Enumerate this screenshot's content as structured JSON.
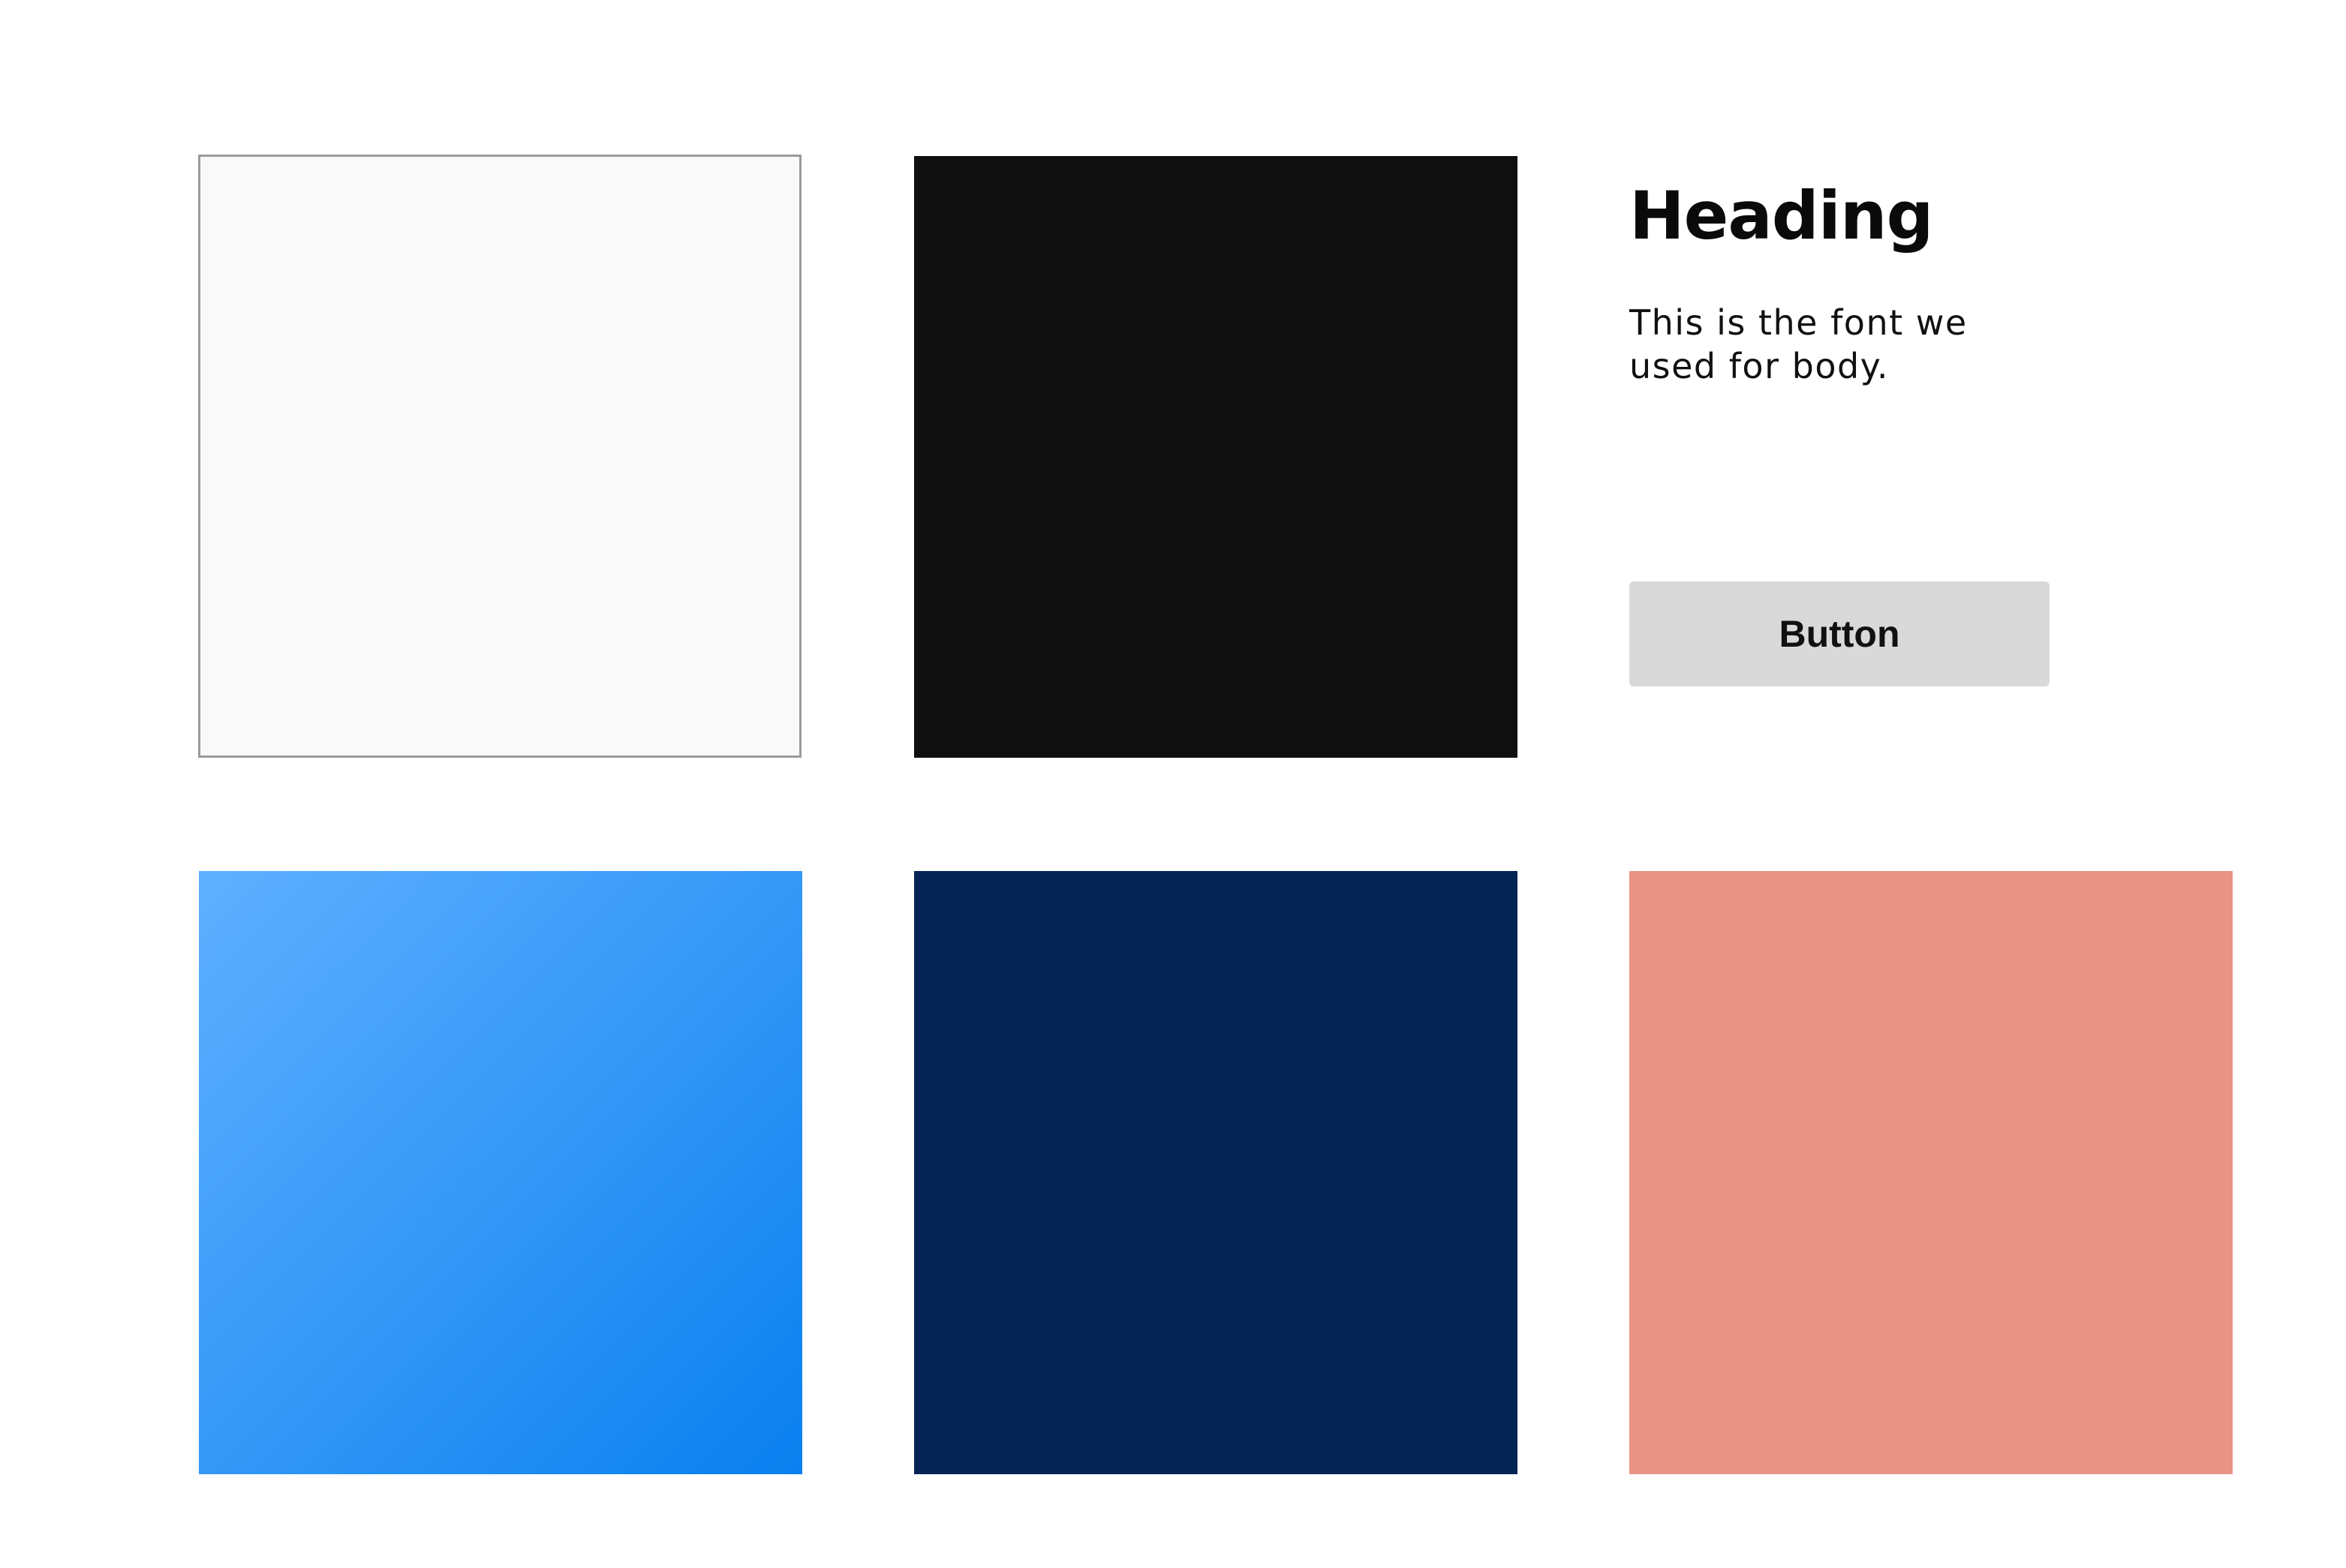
{
  "swatches": {
    "light": {
      "fill": "#f9f9f9",
      "border": "#9a9a9a"
    },
    "black": {
      "fill": "#0f0f0f"
    },
    "blue_gradient": {
      "from": "#5fb0ff",
      "to": "#0a80ef"
    },
    "navy": {
      "fill": "#062557"
    },
    "salmon": {
      "fill": "#ea9387"
    }
  },
  "typography": {
    "heading": "Heading",
    "body": "This is the font we used for body."
  },
  "button": {
    "label": "Button",
    "background": "#d9d9d9"
  }
}
